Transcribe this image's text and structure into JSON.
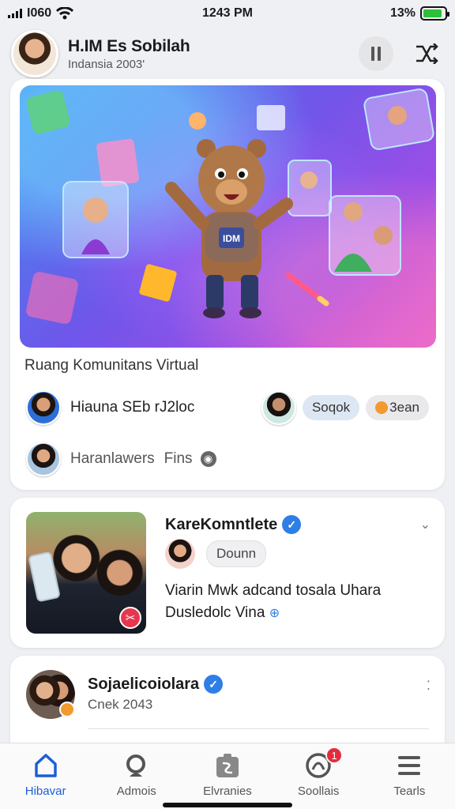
{
  "status_bar": {
    "carrier": "I060",
    "time": "1243 PM",
    "battery": "13%",
    "battery_level": 0.9
  },
  "header": {
    "name": "H.IM Es Sobilah",
    "subtitle": "Indansia 2003'",
    "pause_icon": "pause-icon",
    "shuffle_icon": "shuffle-icon"
  },
  "hero": {
    "badge_text": "IDM"
  },
  "community": {
    "title": "Ruang Komunitans Virtual",
    "row1_name": "Hiauna SEb rJ2loc",
    "chip1": "Soqok",
    "chip2": "3ean",
    "row2_name": "Haranlawers",
    "row2_suffix": "Fins"
  },
  "post": {
    "title": "KareKomntlete",
    "chip": "Dounn",
    "body_line1": "Viarin Mwk adcand tosala Uhara",
    "body_line2": "Dusledolc Vina"
  },
  "card3": {
    "title": "Sojaelicoiolara",
    "subtitle": "Cnek 2043"
  },
  "bottom_nav": {
    "items": [
      {
        "label": "Hibavar",
        "icon": "home-icon"
      },
      {
        "label": "Admois",
        "icon": "search-icon"
      },
      {
        "label": "Elvranies",
        "icon": "events-icon"
      },
      {
        "label": "Soollais",
        "icon": "social-icon",
        "badge": "1"
      },
      {
        "label": "Tearls",
        "icon": "menu-icon"
      }
    ]
  },
  "colors": {
    "accent": "#1c5fd4",
    "verify": "#2f7ee6",
    "badge": "#e32d3d"
  }
}
